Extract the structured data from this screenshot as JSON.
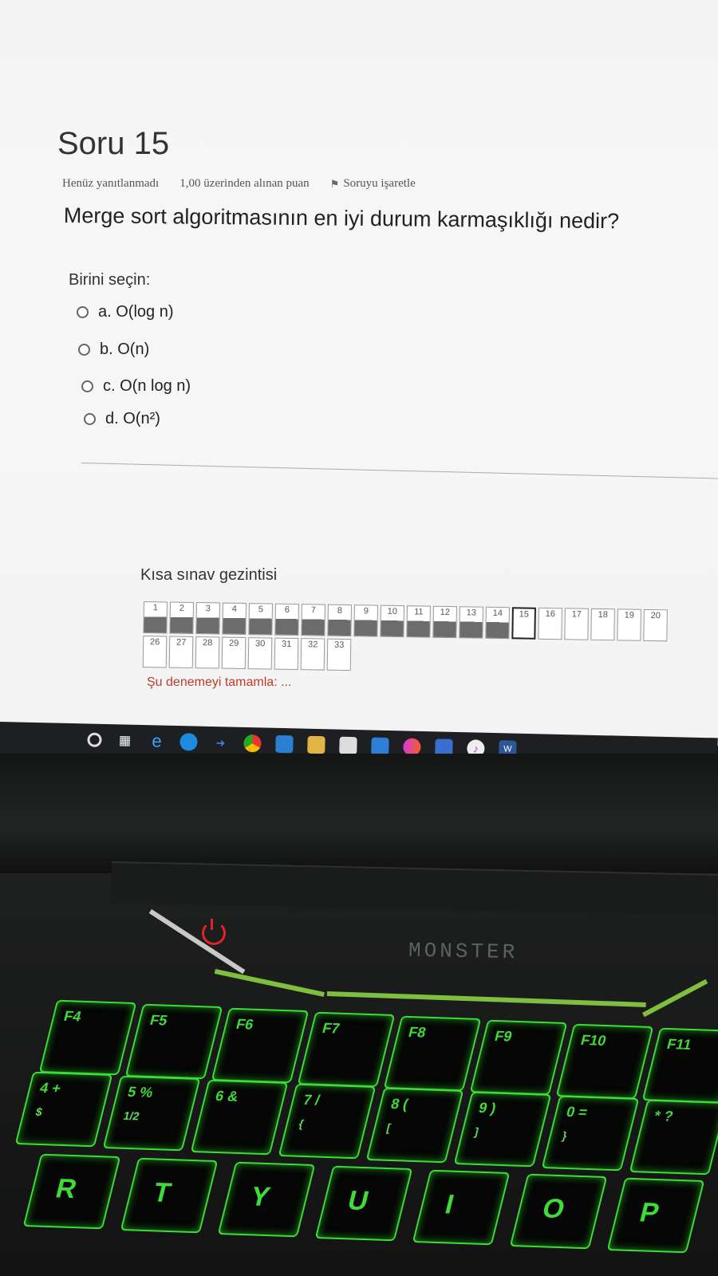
{
  "question": {
    "title": "Soru 15",
    "status": "Henüz yanıtlanmadı",
    "points": "1,00 üzerinden alınan puan",
    "flag_label": "Soruyu işaretle",
    "text": "Merge sort algoritmasının en iyi durum karmaşıklığı nedir?",
    "choose_label": "Birini seçin:",
    "options": [
      {
        "label": "a. O(log n)"
      },
      {
        "label": "b. O(n)"
      },
      {
        "label": "c. O(n log n)"
      },
      {
        "label": "d. O(n²)"
      }
    ]
  },
  "quiz_nav": {
    "title": "Kısa sınav gezintisi",
    "row1": [
      "1",
      "2",
      "3",
      "4",
      "5",
      "6",
      "7",
      "8",
      "9",
      "10",
      "11",
      "12",
      "13",
      "14",
      "15",
      "16",
      "17",
      "18",
      "19",
      "20"
    ],
    "row2": [
      "26",
      "27",
      "28",
      "29",
      "30",
      "31",
      "32",
      "33"
    ],
    "answered_upto": 14,
    "current": "15",
    "finish_link": "Şu denemeyi tamamla: ..."
  },
  "taskbar": {
    "icons": [
      "cortana-icon",
      "task-view-icon",
      "ie-icon",
      "edge-icon",
      "explorer-arrow-icon",
      "chrome-icon",
      "files-icon",
      "folder-icon",
      "store-icon",
      "mail-icon",
      "droplet-icon",
      "app-icon",
      "itunes-icon",
      "word-icon"
    ]
  },
  "laptop": {
    "brand": "MONSTER",
    "keys_top": [
      "F4",
      "F5",
      "F6",
      "F7",
      "F8",
      "F9",
      "F10",
      "F11"
    ],
    "keys_num": [
      "4 +",
      "5 %",
      "6 &",
      "7 /",
      "8 (",
      "9 )",
      "0 =",
      "* ?"
    ],
    "keys_num_sub": [
      "$",
      "1/2",
      "",
      "{",
      "[",
      "]",
      "}",
      ""
    ],
    "keys_alpha": [
      "R",
      "T",
      "Y",
      "U",
      "I",
      "O",
      "P"
    ],
    "accent_color": "#3ddc38"
  }
}
